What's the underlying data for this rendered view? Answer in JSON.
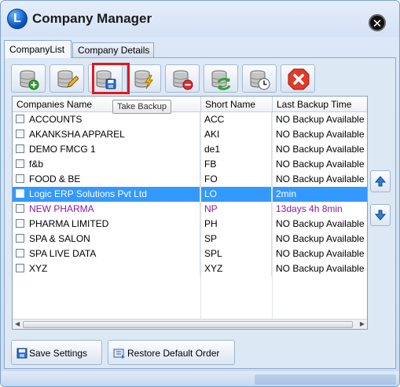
{
  "window": {
    "title": "Company Manager",
    "logo_letter": "L"
  },
  "tabs": [
    {
      "label": "CompanyList"
    },
    {
      "label": "Company Details"
    }
  ],
  "toolbar": {
    "buttons": [
      {
        "icon": "database-add-icon"
      },
      {
        "icon": "database-edit-icon"
      },
      {
        "icon": "database-save-icon"
      },
      {
        "icon": "database-lightning-icon"
      },
      {
        "icon": "database-remove-icon"
      },
      {
        "icon": "database-refresh-icon"
      },
      {
        "icon": "database-clock-icon"
      },
      {
        "icon": "close-red-icon"
      }
    ],
    "tooltip": "Take Backup"
  },
  "grid": {
    "columns": [
      "Companies Name",
      "Short Name",
      "Last Backup Time"
    ],
    "rows": [
      {
        "name": "ACCOUNTS",
        "short": "ACC",
        "backup": "NO Backup Available"
      },
      {
        "name": "AKANKSHA APPAREL",
        "short": "AKI",
        "backup": "NO Backup Available"
      },
      {
        "name": "DEMO FMCG 1",
        "short": "de1",
        "backup": "NO Backup Available"
      },
      {
        "name": "f&b",
        "short": "FB",
        "backup": "NO Backup Available"
      },
      {
        "name": "FOOD & BE",
        "short": "FO",
        "backup": "NO Backup Available"
      },
      {
        "name": "Logic ERP Solutions Pvt Ltd",
        "short": "LO",
        "backup": "2min"
      },
      {
        "name": "NEW PHARMA",
        "short": "NP",
        "backup": "13days 4h 8min"
      },
      {
        "name": "PHARMA LIMITED",
        "short": "PH",
        "backup": "NO Backup Available"
      },
      {
        "name": "SPA & SALON",
        "short": "SP",
        "backup": "NO Backup Available"
      },
      {
        "name": "SPA LIVE DATA",
        "short": "SPL",
        "backup": "NO Backup Available"
      },
      {
        "name": "XYZ",
        "short": "XYZ",
        "backup": "NO Backup Available"
      }
    ]
  },
  "buttons": {
    "save_settings": "Save Settings",
    "restore_default": "Restore Default Order"
  },
  "colors": {
    "selected_row": "#3399ff",
    "highlight_row_text": "#8b1a9c",
    "annotation_box": "#e0181e"
  }
}
